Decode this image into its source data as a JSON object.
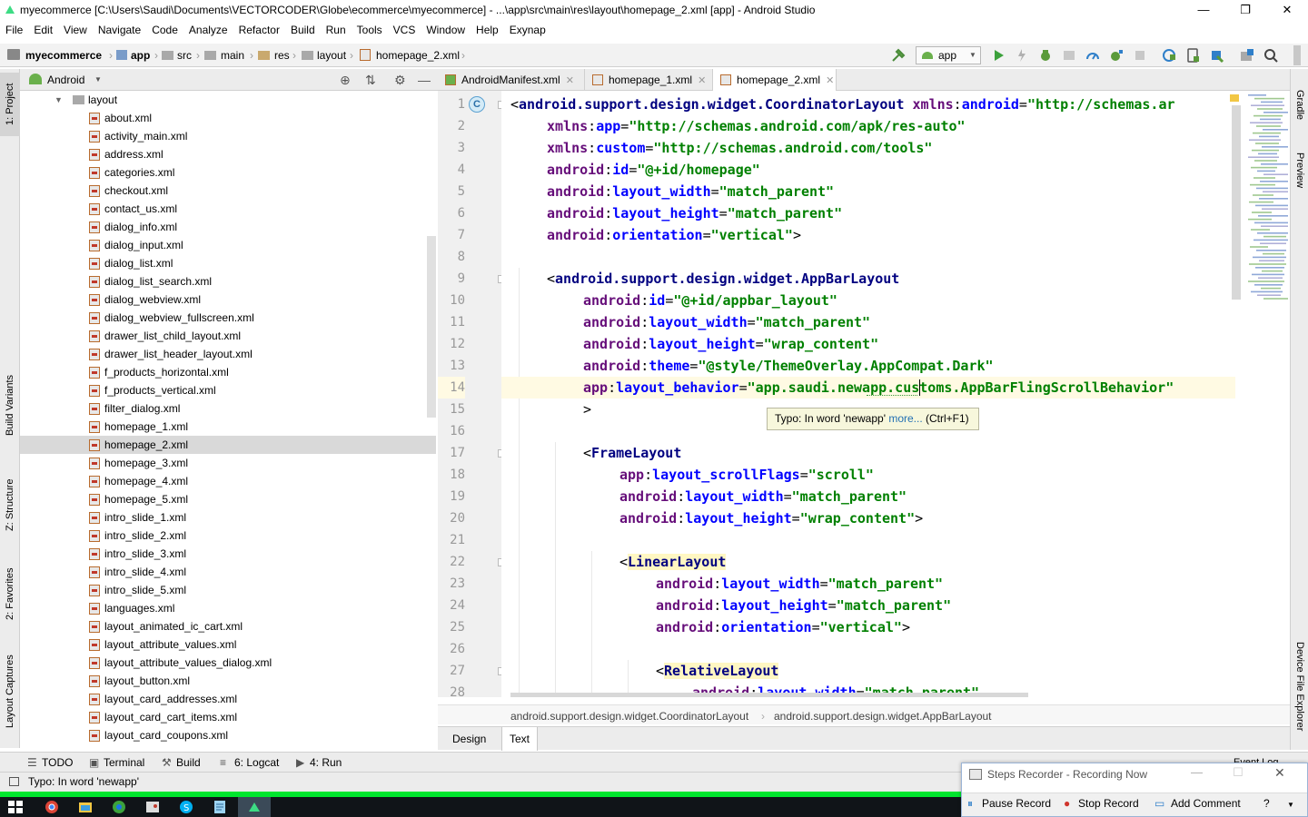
{
  "window": {
    "title": "myecommerce [C:\\Users\\Saudi\\Documents\\VECTORCODER\\Globe\\ecommerce\\myecommerce] - ...\\app\\src\\main\\res\\layout\\homepage_2.xml [app] - Android Studio",
    "minimize": "—",
    "maximize": "❐",
    "close": "✕"
  },
  "menu": [
    "File",
    "Edit",
    "View",
    "Navigate",
    "Code",
    "Analyze",
    "Refactor",
    "Build",
    "Run",
    "Tools",
    "VCS",
    "Window",
    "Help",
    "Exynap"
  ],
  "breadcrumb": [
    "myecommerce",
    "app",
    "src",
    "main",
    "res",
    "layout",
    "homepage_2.xml"
  ],
  "toolbar": {
    "run_config": "app"
  },
  "left_tool_tabs": [
    "1: Project",
    "Build Variants",
    "Z: Structure",
    "2: Favorites",
    "Layout Captures"
  ],
  "right_tool_tabs": [
    "Gradle",
    "Preview",
    "Device File Explorer"
  ],
  "project": {
    "view_mode": "Android",
    "folder": "layout",
    "selected": "homepage_2.xml",
    "files": [
      "about.xml",
      "activity_main.xml",
      "address.xml",
      "categories.xml",
      "checkout.xml",
      "contact_us.xml",
      "dialog_info.xml",
      "dialog_input.xml",
      "dialog_list.xml",
      "dialog_list_search.xml",
      "dialog_webview.xml",
      "dialog_webview_fullscreen.xml",
      "drawer_list_child_layout.xml",
      "drawer_list_header_layout.xml",
      "f_products_horizontal.xml",
      "f_products_vertical.xml",
      "filter_dialog.xml",
      "homepage_1.xml",
      "homepage_2.xml",
      "homepage_3.xml",
      "homepage_4.xml",
      "homepage_5.xml",
      "intro_slide_1.xml",
      "intro_slide_2.xml",
      "intro_slide_3.xml",
      "intro_slide_4.xml",
      "intro_slide_5.xml",
      "languages.xml",
      "layout_animated_ic_cart.xml",
      "layout_attribute_values.xml",
      "layout_attribute_values_dialog.xml",
      "layout_button.xml",
      "layout_card_addresses.xml",
      "layout_card_cart_items.xml",
      "layout_card_coupons.xml"
    ]
  },
  "editor_tabs": [
    "AndroidManifest.xml",
    "homepage_1.xml",
    "homepage_2.xml"
  ],
  "active_tab": "homepage_2.xml",
  "line_numbers": [
    "1",
    "2",
    "3",
    "4",
    "5",
    "6",
    "7",
    "8",
    "9",
    "10",
    "11",
    "12",
    "13",
    "14",
    "15",
    "16",
    "17",
    "18",
    "19",
    "20",
    "21",
    "22",
    "23",
    "24",
    "25",
    "26",
    "27",
    "28"
  ],
  "code": [
    {
      "i": 0,
      "parts": [
        [
          "p",
          "<"
        ],
        [
          "tag",
          "android.support.design.widget.CoordinatorLayout"
        ],
        [
          "p",
          " "
        ],
        [
          "ns",
          "xmlns"
        ],
        [
          "p",
          ":"
        ],
        [
          "at",
          "android"
        ],
        [
          "p",
          "="
        ],
        [
          "vl",
          "\"http://schemas.ar"
        ]
      ]
    },
    {
      "i": 1,
      "parts": [
        [
          "ns",
          "xmlns"
        ],
        [
          "p",
          ":"
        ],
        [
          "at",
          "app"
        ],
        [
          "p",
          "="
        ],
        [
          "vl",
          "\"http://schemas.android.com/apk/res-auto\""
        ]
      ]
    },
    {
      "i": 1,
      "parts": [
        [
          "ns",
          "xmlns"
        ],
        [
          "p",
          ":"
        ],
        [
          "at",
          "custom"
        ],
        [
          "p",
          "="
        ],
        [
          "vl",
          "\"http://schemas.android.com/tools\""
        ]
      ]
    },
    {
      "i": 1,
      "parts": [
        [
          "ns",
          "android"
        ],
        [
          "p",
          ":"
        ],
        [
          "at",
          "id"
        ],
        [
          "p",
          "="
        ],
        [
          "vl",
          "\"@+id/homepage\""
        ]
      ]
    },
    {
      "i": 1,
      "parts": [
        [
          "ns",
          "android"
        ],
        [
          "p",
          ":"
        ],
        [
          "at",
          "layout_width"
        ],
        [
          "p",
          "="
        ],
        [
          "vl",
          "\"match_parent\""
        ]
      ]
    },
    {
      "i": 1,
      "parts": [
        [
          "ns",
          "android"
        ],
        [
          "p",
          ":"
        ],
        [
          "at",
          "layout_height"
        ],
        [
          "p",
          "="
        ],
        [
          "vl",
          "\"match_parent\""
        ]
      ]
    },
    {
      "i": 1,
      "parts": [
        [
          "ns",
          "android"
        ],
        [
          "p",
          ":"
        ],
        [
          "at",
          "orientation"
        ],
        [
          "p",
          "="
        ],
        [
          "vl",
          "\"vertical\""
        ],
        [
          "p",
          ">"
        ]
      ]
    },
    {
      "i": 0,
      "parts": []
    },
    {
      "i": 1,
      "parts": [
        [
          "p",
          "<"
        ],
        [
          "tag",
          "android.support.design.widget.AppBarLayout"
        ]
      ]
    },
    {
      "i": 2,
      "parts": [
        [
          "ns",
          "android"
        ],
        [
          "p",
          ":"
        ],
        [
          "at",
          "id"
        ],
        [
          "p",
          "="
        ],
        [
          "vl",
          "\"@+id/appbar_layout\""
        ]
      ]
    },
    {
      "i": 2,
      "parts": [
        [
          "ns",
          "android"
        ],
        [
          "p",
          ":"
        ],
        [
          "at",
          "layout_width"
        ],
        [
          "p",
          "="
        ],
        [
          "vl",
          "\"match_parent\""
        ]
      ]
    },
    {
      "i": 2,
      "parts": [
        [
          "ns",
          "android"
        ],
        [
          "p",
          ":"
        ],
        [
          "at",
          "layout_height"
        ],
        [
          "p",
          "="
        ],
        [
          "vl",
          "\"wrap_content\""
        ]
      ]
    },
    {
      "i": 2,
      "parts": [
        [
          "ns",
          "android"
        ],
        [
          "p",
          ":"
        ],
        [
          "at",
          "theme"
        ],
        [
          "p",
          "="
        ],
        [
          "vl",
          "\"@style/ThemeOverlay.AppCompat.Dark\""
        ]
      ]
    },
    {
      "i": 2,
      "parts": [
        [
          "ns",
          "app"
        ],
        [
          "p",
          ":"
        ],
        [
          "at",
          "layout_behavior"
        ],
        [
          "p",
          "="
        ],
        [
          "vl",
          "\"app.saudi.newapp.customs.AppBarFlingScrollBehavior\""
        ]
      ]
    },
    {
      "i": 2,
      "parts": [
        [
          "p",
          ">"
        ]
      ]
    },
    {
      "i": 0,
      "parts": []
    },
    {
      "i": 2,
      "parts": [
        [
          "p",
          "<"
        ],
        [
          "tag",
          "FrameLayout"
        ]
      ]
    },
    {
      "i": 3,
      "parts": [
        [
          "ns",
          "app"
        ],
        [
          "p",
          ":"
        ],
        [
          "at",
          "layout_scrollFlags"
        ],
        [
          "p",
          "="
        ],
        [
          "vl",
          "\"scroll\""
        ]
      ]
    },
    {
      "i": 3,
      "parts": [
        [
          "ns",
          "android"
        ],
        [
          "p",
          ":"
        ],
        [
          "at",
          "layout_width"
        ],
        [
          "p",
          "="
        ],
        [
          "vl",
          "\"match_parent\""
        ]
      ]
    },
    {
      "i": 3,
      "parts": [
        [
          "ns",
          "android"
        ],
        [
          "p",
          ":"
        ],
        [
          "at",
          "layout_height"
        ],
        [
          "p",
          "="
        ],
        [
          "vl",
          "\"wrap_content\""
        ],
        [
          "p",
          ">"
        ]
      ]
    },
    {
      "i": 0,
      "parts": []
    },
    {
      "i": 3,
      "parts": [
        [
          "p",
          "<"
        ],
        [
          "tagh",
          "LinearLayout"
        ]
      ]
    },
    {
      "i": 4,
      "parts": [
        [
          "ns",
          "android"
        ],
        [
          "p",
          ":"
        ],
        [
          "at",
          "layout_width"
        ],
        [
          "p",
          "="
        ],
        [
          "vl",
          "\"match_parent\""
        ]
      ]
    },
    {
      "i": 4,
      "parts": [
        [
          "ns",
          "android"
        ],
        [
          "p",
          ":"
        ],
        [
          "at",
          "layout_height"
        ],
        [
          "p",
          "="
        ],
        [
          "vl",
          "\"match_parent\""
        ]
      ]
    },
    {
      "i": 4,
      "parts": [
        [
          "ns",
          "android"
        ],
        [
          "p",
          ":"
        ],
        [
          "at",
          "orientation"
        ],
        [
          "p",
          "="
        ],
        [
          "vl",
          "\"vertical\""
        ],
        [
          "p",
          ">"
        ]
      ]
    },
    {
      "i": 0,
      "parts": []
    },
    {
      "i": 4,
      "parts": [
        [
          "p",
          "<"
        ],
        [
          "tagh",
          "RelativeLayout"
        ]
      ]
    },
    {
      "i": 5,
      "parts": [
        [
          "ns",
          "android"
        ],
        [
          "p",
          ":"
        ],
        [
          "at",
          "layout_width"
        ],
        [
          "p",
          "="
        ],
        [
          "vl",
          "\"match_parent\""
        ]
      ]
    }
  ],
  "current_line": 14,
  "tooltip": {
    "text": "Typo: In word 'newapp' ",
    "link": "more...",
    "shortcut": " (Ctrl+F1)"
  },
  "editor_breadcrumb": [
    "android.support.design.widget.CoordinatorLayout",
    "android.support.design.widget.AppBarLayout"
  ],
  "design_tabs": [
    "Design",
    "Text"
  ],
  "active_design_tab": "Text",
  "bottom_tools": [
    "TODO",
    "Terminal",
    "Build",
    "6: Logcat",
    "4: Run"
  ],
  "event_log": "Event Log",
  "status": "Typo: In word 'newapp'",
  "steps_recorder": {
    "title": "Steps Recorder - Recording Now",
    "pause": "Pause Record",
    "stop": "Stop Record",
    "comment": "Add Comment"
  },
  "colors": {
    "tag": "#000080",
    "namespace": "#660e7a",
    "attribute": "#0000ff",
    "value": "#008000",
    "taskbar_accent": "#00e62e"
  }
}
